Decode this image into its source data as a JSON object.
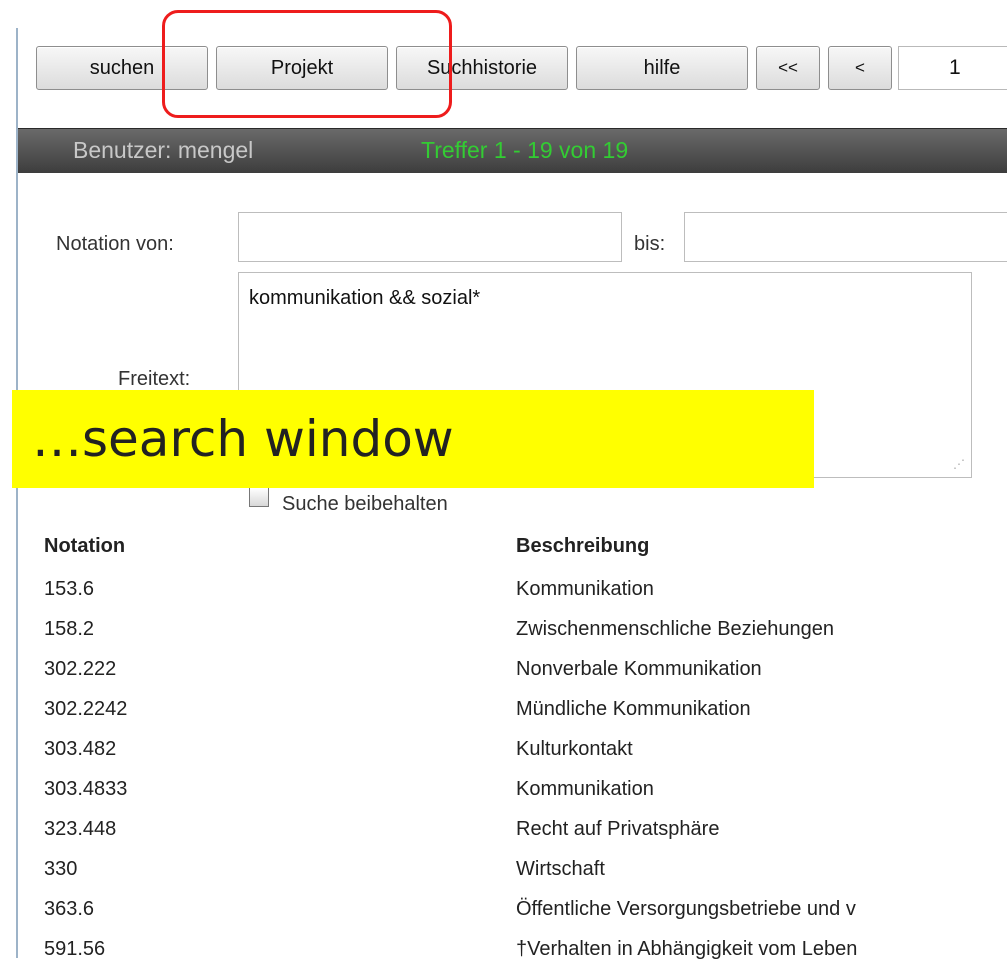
{
  "toolbar": {
    "buttons": [
      "suchen",
      "Projekt",
      "Suchhistorie",
      "hilfe",
      "<<",
      "<"
    ],
    "page_value": "1"
  },
  "status": {
    "user": "Benutzer: mengel",
    "hits": "Treffer 1 - 19 von 19"
  },
  "form": {
    "notation_from_label": "Notation von:",
    "notation_to_label": "bis:",
    "notation_from_value": "",
    "notation_to_value": "",
    "freitext_label": "Freitext:",
    "freitext_value": "kommunikation && sozial*",
    "keep_search_label": "Suche beibehalten",
    "keep_search_checked": false
  },
  "overlay": {
    "caption": "…search window"
  },
  "results": {
    "headers": [
      "Notation",
      "Beschreibung"
    ],
    "rows": [
      [
        "153.6",
        "Kommunikation"
      ],
      [
        "158.2",
        "Zwischenmenschliche Beziehungen"
      ],
      [
        "302.222",
        "Nonverbale Kommunikation"
      ],
      [
        "302.2242",
        "Mündliche Kommunikation"
      ],
      [
        "303.482",
        "Kulturkontakt"
      ],
      [
        "303.4833",
        "Kommunikation"
      ],
      [
        "323.448",
        "Recht auf Privatsphäre"
      ],
      [
        "330",
        "Wirtschaft"
      ],
      [
        "363.6",
        "Öffentliche Versorgungsbetriebe und v"
      ],
      [
        "591.56",
        "†Verhalten in Abhängigkeit vom Leben"
      ]
    ]
  },
  "colors": {
    "status_bg": "#4a4a4a",
    "hits_text": "#33cc33",
    "highlight_border": "#ee1c1c",
    "banner_bg": "#ffff00"
  }
}
